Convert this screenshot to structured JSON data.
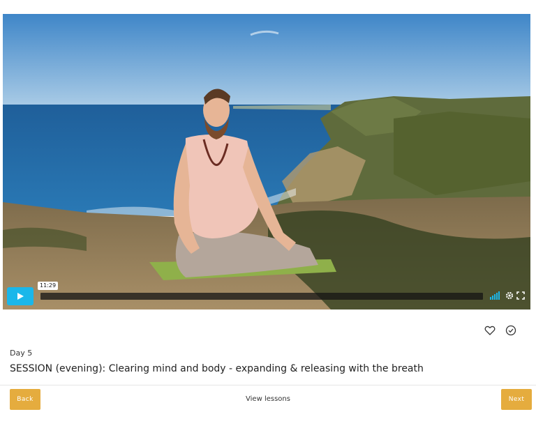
{
  "video": {
    "timecode": "11:29",
    "progress": 0,
    "accent_color": "#1ab7ea",
    "icons": [
      "play-icon",
      "volume-icon",
      "settings-icon",
      "fullscreen-icon"
    ]
  },
  "actions": {
    "icons": [
      "heart-icon",
      "check-circle-icon"
    ]
  },
  "lesson": {
    "day": "Day 5",
    "title": "SESSION (evening): Clearing mind and body - expanding & releasing with the breath"
  },
  "footer": {
    "back_label": "Back",
    "view_lessons_label": "View lessons",
    "next_label": "Next",
    "button_color": "#e5ac3e"
  }
}
